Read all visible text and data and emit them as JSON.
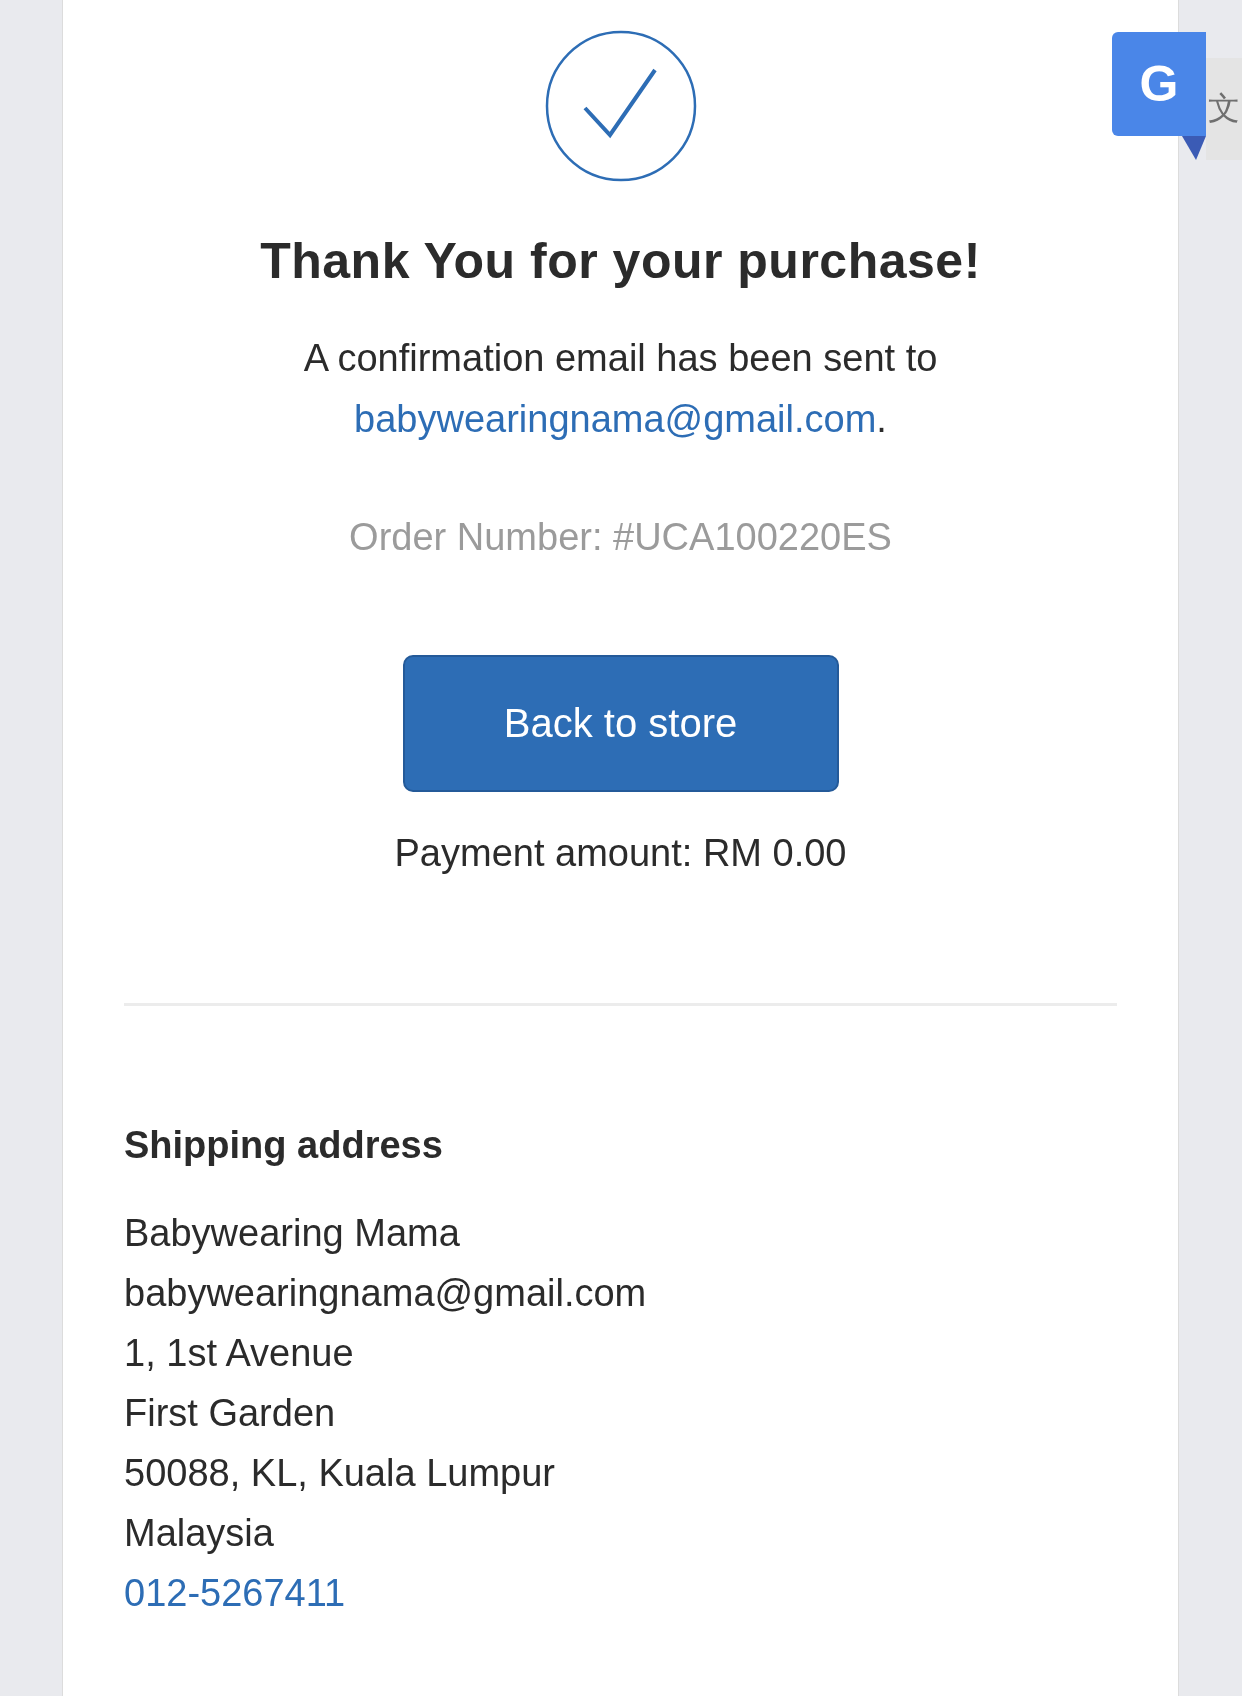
{
  "title": "Thank You for your purchase!",
  "confirmation": {
    "text": "A confirmation email has been sent to",
    "email": "babywearingnama@gmail.com",
    "period": "."
  },
  "order_number": "Order Number: #UCA100220ES",
  "button": "Back to store",
  "payment": "Payment amount: RM 0.00",
  "shipping": {
    "heading": "Shipping address",
    "lines": [
      "Babywearing Mama",
      "babywearingnama@gmail.com",
      "1, 1st Avenue",
      "First Garden",
      "50088, KL, Kuala Lumpur",
      "Malaysia"
    ],
    "phone": "012-5267411"
  },
  "translate_badge": {
    "letter": "G",
    "glyph": "文"
  }
}
